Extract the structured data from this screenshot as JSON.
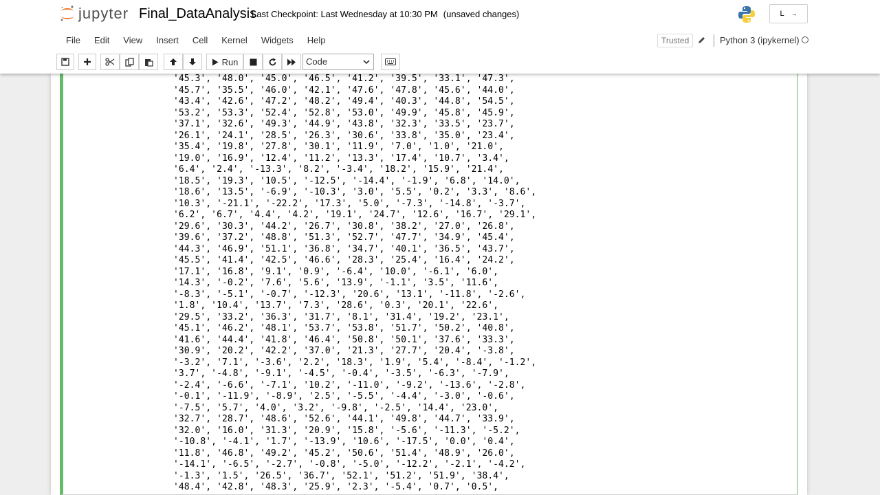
{
  "app": {
    "logo_text": "jupyter",
    "notebook_name": "Final_DataAnalysis",
    "checkpoint": "Last Checkpoint: Last Wednesday at 10:30 PM",
    "save_status": "(unsaved changes)",
    "login_label": "L"
  },
  "menubar": {
    "items": [
      "File",
      "Edit",
      "View",
      "Insert",
      "Cell",
      "Kernel",
      "Widgets",
      "Help"
    ],
    "trusted": "Trusted",
    "kernel": "Python 3 (ipykernel)"
  },
  "toolbar": {
    "run_label": "Run",
    "cell_type": "Code"
  },
  "colors": {
    "accent_green": "#66bb6a",
    "header_bg": "#ffffff",
    "page_bg": "#eeeeee"
  },
  "output": {
    "lines": [
      "'45.3', '48.0', '45.0', '46.5', '41.2', '39.5', '33.1', '47.3',",
      "'45.7', '35.5', '46.0', '42.1', '47.6', '47.8', '45.6', '44.0',",
      "'43.4', '42.6', '47.2', '48.2', '49.4', '40.3', '44.8', '54.5',",
      "'53.2', '53.3', '52.4', '52.8', '53.0', '49.9', '45.8', '45.9',",
      "'37.1', '32.6', '49.3', '44.9', '43.8', '32.3', '33.5', '23.7',",
      "'26.1', '24.1', '28.5', '26.3', '30.6', '33.8', '35.0', '23.4',",
      "'35.4', '19.8', '27.8', '30.1', '11.9', '7.0', '1.0', '21.0',",
      "'19.0', '16.9', '12.4', '11.2', '13.3', '17.4', '10.7', '3.4',",
      "'6.4', '2.4', '-13.3', '8.2', '-3.4', '18.2', '15.9', '21.4',",
      "'18.5', '19.3', '10.5', '-12.5', '-14.4', '-1.9', '6.8', '14.0',",
      "'18.6', '13.5', '-6.9', '-10.3', '3.0', '5.5', '0.2', '3.3', '8.6',",
      "'10.3', '-21.1', '-22.2', '17.3', '5.0', '-7.3', '-14.8', '-3.7',",
      "'6.2', '6.7', '4.4', '4.2', '19.1', '24.7', '12.6', '16.7', '29.1',",
      "'29.6', '30.3', '44.2', '26.7', '30.8', '38.2', '27.0', '26.8',",
      "'39.6', '37.2', '48.8', '51.3', '52.7', '47.7', '34.9', '45.4',",
      "'44.3', '46.9', '51.1', '36.8', '34.7', '40.1', '36.5', '43.7',",
      "'45.5', '41.4', '42.5', '46.6', '28.3', '25.4', '16.4', '24.2',",
      "'17.1', '16.8', '9.1', '0.9', '-6.4', '10.0', '-6.1', '6.0',",
      "'14.3', '-0.2', '7.6', '5.6', '13.9', '-1.1', '3.5', '11.6',",
      "'-8.3', '-5.1', '-0.7', '-12.3', '20.6', '13.1', '-11.8', '-2.6',",
      "'1.8', '10.4', '13.7', '7.3', '28.6', '0.3', '20.1', '22.6',",
      "'29.5', '33.2', '36.3', '31.7', '8.1', '31.4', '19.2', '23.1',",
      "'45.1', '46.2', '48.1', '53.7', '53.8', '51.7', '50.2', '40.8',",
      "'41.6', '44.4', '41.8', '46.4', '50.8', '50.1', '37.6', '33.3',",
      "'30.9', '20.2', '42.2', '37.0', '21.3', '27.7', '20.4', '-3.8',",
      "'-3.2', '7.1', '-3.6', '2.2', '18.3', '1.9', '5.4', '-8.4', '-1.2',",
      "'3.7', '-4.8', '-9.1', '-4.5', '-0.4', '-3.5', '-6.3', '-7.9',",
      "'-2.4', '-6.6', '-7.1', '10.2', '-11.0', '-9.2', '-13.6', '-2.8',",
      "'-0.1', '-11.9', '-8.9', '2.5', '-5.5', '-4.4', '-3.0', '-0.6',",
      "'-7.5', '5.7', '4.0', '3.2', '-9.8', '-2.5', '14.4', '23.0',",
      "'32.7', '28.7', '48.6', '52.6', '44.1', '49.8', '44.7', '33.9',",
      "'32.0', '16.0', '31.3', '20.9', '15.8', '-5.6', '-11.3', '-5.2',",
      "'-10.8', '-4.1', '1.7', '-13.9', '10.6', '-17.5', '0.0', '0.4',",
      "'11.8', '46.8', '49.2', '45.2', '50.6', '51.4', '48.9', '26.0',",
      "'-14.1', '-6.5', '-2.7', '-0.8', '-5.0', '-12.2', '-2.1', '-4.2',",
      "'-1.3', '1.5', '26.5', '36.7', '52.1', '51.2', '51.9', '38.4',",
      "'48.4', '42.8', '48.3', '25.9', '2.3', '-5.4', '0.7', '0.5',"
    ]
  }
}
